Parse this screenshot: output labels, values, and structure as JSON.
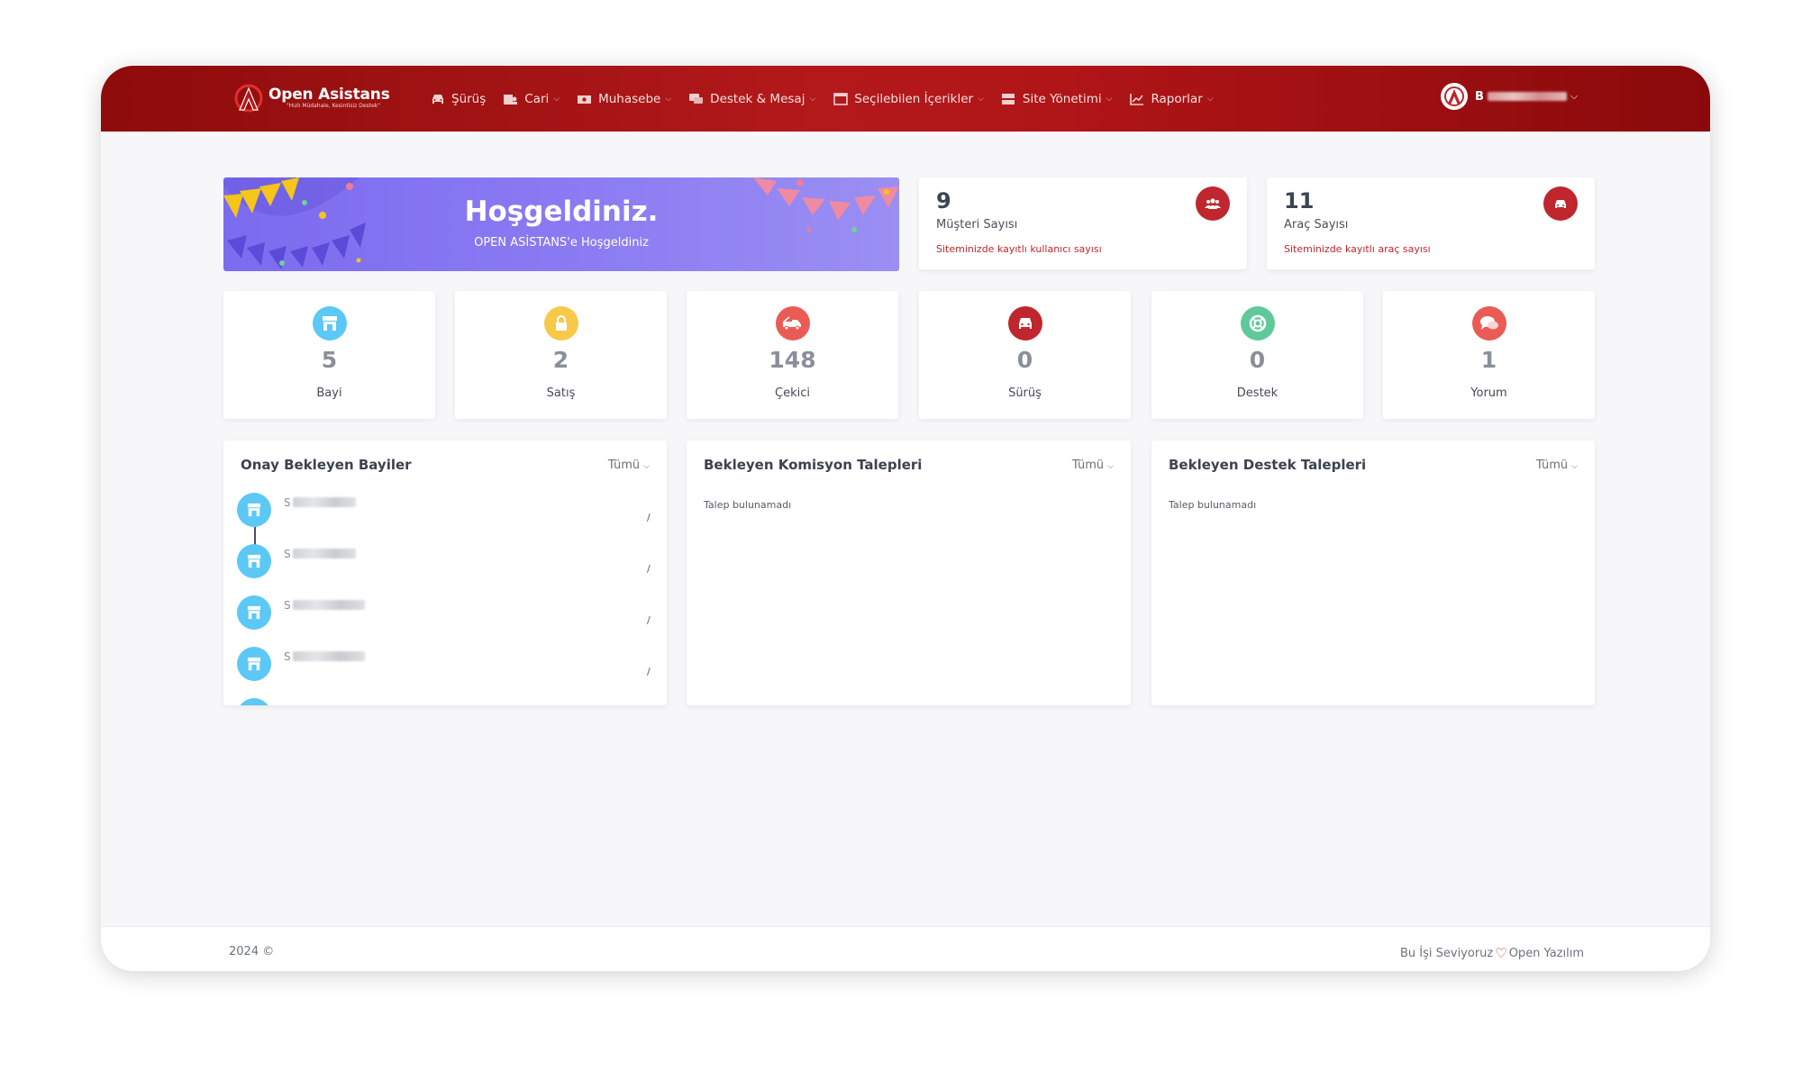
{
  "brand": {
    "name": "Open Asistans",
    "tagline": "\"Hızlı Müdahale, Kesintisiz Destek\""
  },
  "nav": {
    "items": [
      {
        "label": "Şürüş",
        "icon": "car-icon",
        "dropdown": false
      },
      {
        "label": "Cari",
        "icon": "users-icon",
        "dropdown": true
      },
      {
        "label": "Muhasebe",
        "icon": "money-icon",
        "dropdown": true
      },
      {
        "label": "Destek & Mesaj",
        "icon": "chat-icon",
        "dropdown": true
      },
      {
        "label": "Seçilebilen İçerikler",
        "icon": "window-icon",
        "dropdown": true
      },
      {
        "label": "Site Yönetimi",
        "icon": "server-icon",
        "dropdown": true
      },
      {
        "label": "Raporlar",
        "icon": "chart-icon",
        "dropdown": true
      }
    ],
    "chevron": "⌵"
  },
  "user": {
    "initial": "B",
    "chevron": "⌵"
  },
  "welcome": {
    "title": "Hoşgeldiniz.",
    "subtitle": "OPEN ASİSTANS'e Hoşgeldiniz"
  },
  "stats": [
    {
      "value": "9",
      "label": "Müşteri Sayısı",
      "note": "Siteminizde kayıtlı kullanıcı sayısı",
      "icon": "users-icon"
    },
    {
      "value": "11",
      "label": "Araç Sayısı",
      "note": "Siteminizde kayıtlı araç sayısı",
      "icon": "car-icon"
    }
  ],
  "mini_stats": [
    {
      "value": "5",
      "label": "Bayi",
      "icon": "store-icon",
      "color": "#5bc8f5"
    },
    {
      "value": "2",
      "label": "Satış",
      "icon": "lock-icon",
      "color": "#f7c948"
    },
    {
      "value": "148",
      "label": "Çekici",
      "icon": "tow-truck-icon",
      "color": "#ea5b55"
    },
    {
      "value": "0",
      "label": "Sürüş",
      "icon": "car-icon",
      "color": "#c0262d"
    },
    {
      "value": "0",
      "label": "Destek",
      "icon": "support-icon",
      "color": "#5fc99a"
    },
    {
      "value": "1",
      "label": "Yorum",
      "icon": "comments-icon",
      "color": "#ea5b55"
    }
  ],
  "panels": {
    "dealers": {
      "title": "Onay Bekleyen Bayiler",
      "filter": "Tümü",
      "items": [
        "S",
        "S",
        "S",
        "S"
      ],
      "slash": "/"
    },
    "commission": {
      "title": "Bekleyen Komisyon Talepleri",
      "filter": "Tümü",
      "empty": "Talep bulunamadı"
    },
    "support": {
      "title": "Bekleyen Destek Talepleri",
      "filter": "Tümü",
      "empty": "Talep bulunamadı"
    }
  },
  "footer": {
    "left": "2024 ©",
    "right_prefix": "Bu İşi Seviyoruz",
    "right_suffix": "Open Yazılım"
  },
  "colors": {
    "brand": "#b3191b",
    "accent_red": "#c0262d",
    "welcome": "#8577f2",
    "info": "#5bc8f5"
  }
}
